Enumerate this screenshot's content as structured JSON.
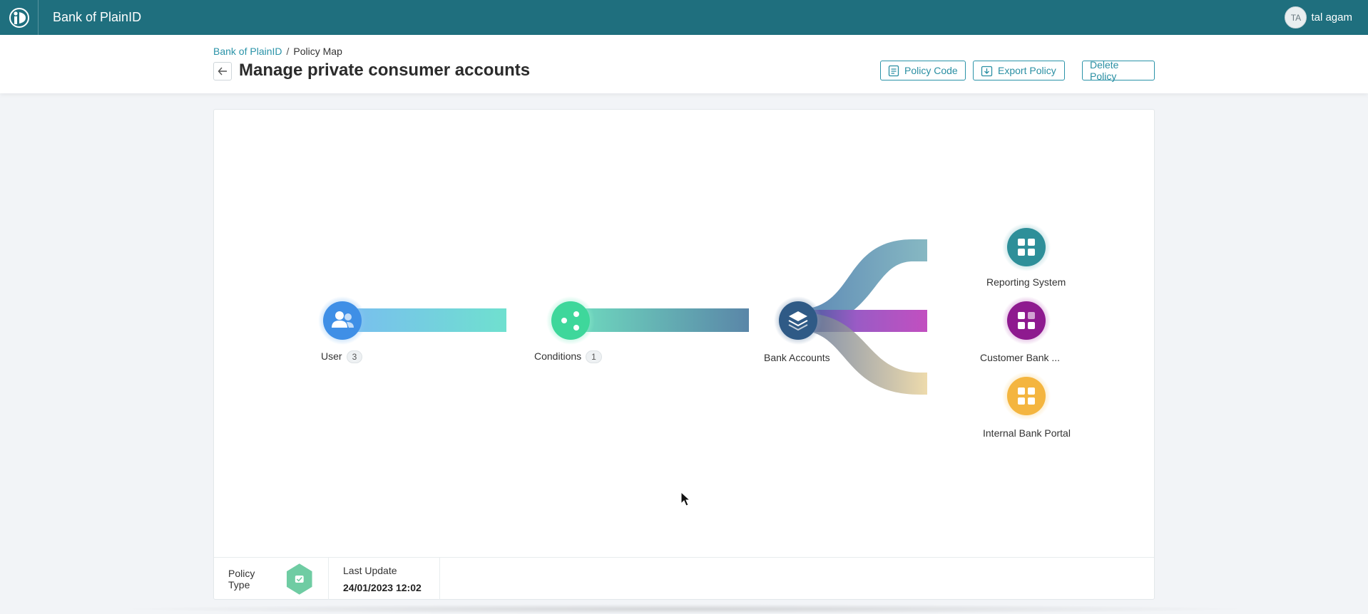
{
  "app": {
    "name": "Bank of PlainID"
  },
  "user": {
    "initials": "TA",
    "name": "tal agam"
  },
  "breadcrumb": {
    "root": "Bank of PlainID",
    "separator": "/",
    "current": "Policy Map"
  },
  "page": {
    "title": "Manage private consumer accounts"
  },
  "actions": {
    "policy_code": "Policy Code",
    "export_policy": "Export Policy",
    "delete_policy": "Delete Policy"
  },
  "map": {
    "nodes": {
      "user": {
        "label": "User",
        "count": "3",
        "icon": "users-icon",
        "color": "#3f8fe6"
      },
      "conditions": {
        "label": "Conditions",
        "count": "1",
        "icon": "share-nodes-icon",
        "color": "#3ed79b"
      },
      "bank_accounts": {
        "label": "Bank Accounts",
        "icon": "layers-icon",
        "color": "#2f5a86"
      },
      "reporting_system": {
        "label": "Reporting System",
        "icon": "app-grid-icon",
        "color": "#2e8f99"
      },
      "customer_bank": {
        "label": "Customer Bank ...",
        "icon": "app-grid-icon",
        "color": "#8e1a8f"
      },
      "internal_bank_portal": {
        "label": "Internal Bank Portal",
        "icon": "app-grid-icon",
        "color": "#f4b53f"
      }
    }
  },
  "footer": {
    "policy_type_label": "Policy Type",
    "last_update_label": "Last Update",
    "last_update_value": "24/01/2023 12:02"
  }
}
